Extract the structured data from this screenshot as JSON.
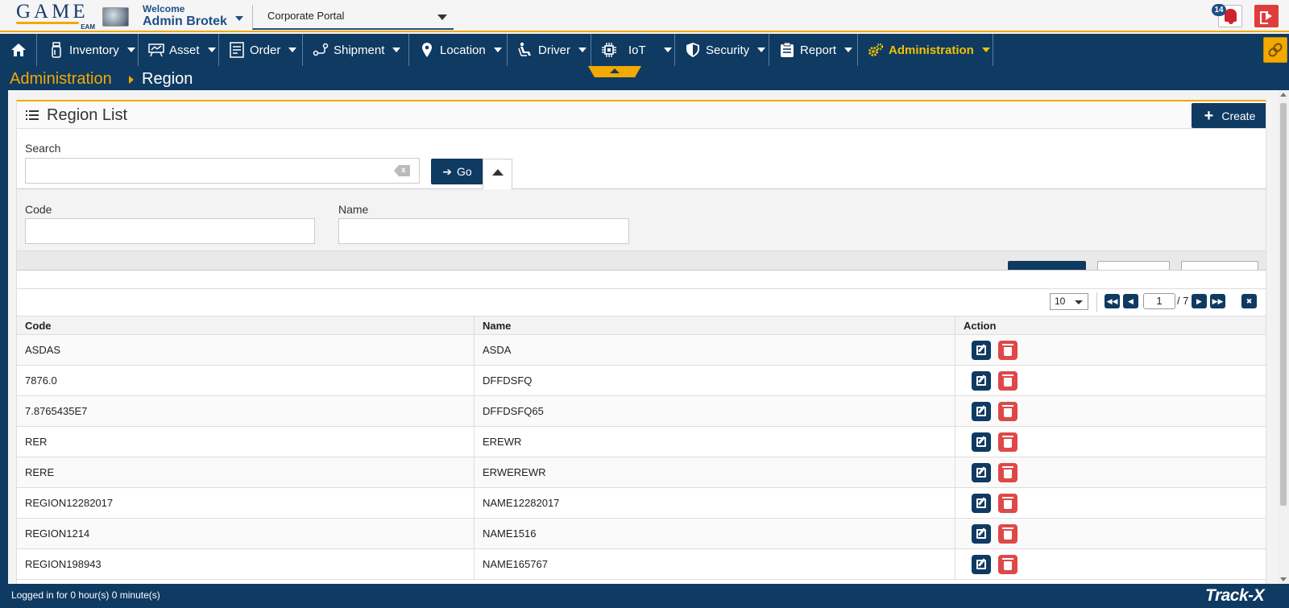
{
  "header": {
    "logo_text": "GAME",
    "logo_sub": "EAM",
    "welcome": "Welcome",
    "user_name": "Admin Brotek",
    "portal": "Corporate Portal",
    "notification_count": "14"
  },
  "nav": {
    "items": [
      {
        "label": "",
        "icon": "home-icon"
      },
      {
        "label": "Inventory",
        "icon": "inventory-icon"
      },
      {
        "label": "Asset",
        "icon": "asset-icon"
      },
      {
        "label": "Order",
        "icon": "order-icon"
      },
      {
        "label": "Shipment",
        "icon": "shipment-icon"
      },
      {
        "label": "Location",
        "icon": "location-icon"
      },
      {
        "label": "Driver",
        "icon": "driver-icon"
      },
      {
        "label": "IoT",
        "icon": "iot-icon"
      },
      {
        "label": "Security",
        "icon": "shield-icon"
      },
      {
        "label": "Report",
        "icon": "report-icon"
      },
      {
        "label": "Administration",
        "icon": "gears-icon",
        "active": true
      }
    ]
  },
  "breadcrumb": {
    "parent": "Administration",
    "current": "Region"
  },
  "panel": {
    "title": "Region List",
    "create_label": "Create"
  },
  "search": {
    "label": "Search",
    "value": "",
    "go_label": "Go"
  },
  "filters": {
    "code_label": "Code",
    "name_label": "Name"
  },
  "pager": {
    "page_size": "10",
    "current_page": "1",
    "total": "/ 7"
  },
  "table": {
    "headers": [
      "Code",
      "Name",
      "Action"
    ],
    "rows": [
      {
        "code": "ASDAS",
        "name": "ASDA"
      },
      {
        "code": "7876.0",
        "name": "DFFDSFQ"
      },
      {
        "code": "7.8765435E7",
        "name": "DFFDSFQ65"
      },
      {
        "code": "RER",
        "name": "EREWR"
      },
      {
        "code": "RERE",
        "name": "ERWEREWR"
      },
      {
        "code": "REGION12282017",
        "name": "NAME12282017"
      },
      {
        "code": "REGION1214",
        "name": "NAME1516"
      },
      {
        "code": "REGION198943",
        "name": "NAME165767"
      }
    ]
  },
  "footer": {
    "login_status": "Logged in for 0 hour(s) 0 minute(s)",
    "brand": "Track-X"
  },
  "colors": {
    "nav_bg": "#0f3a62",
    "accent": "#f2a900",
    "danger": "#e04848"
  }
}
